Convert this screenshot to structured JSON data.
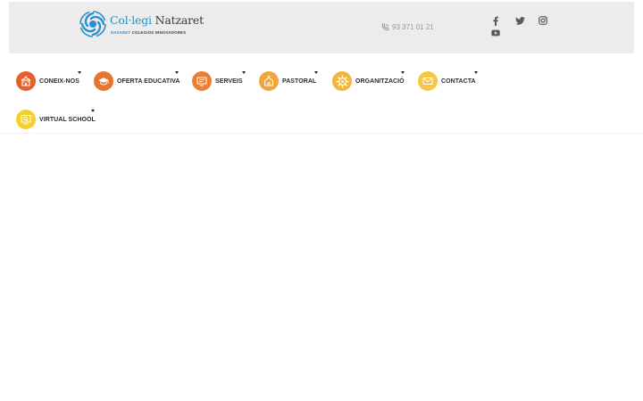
{
  "header": {
    "logo": {
      "name_part1": "Col·legi",
      "name_part2": "Natzaret",
      "tagline_part1": "NAZARET",
      "tagline_part2": "COLEGIOS INNOVADORES"
    },
    "phone": {
      "number": "93 371 01 21",
      "icon": "phone-icon"
    },
    "social": [
      {
        "name": "facebook",
        "icon": "facebook-icon"
      },
      {
        "name": "twitter",
        "icon": "twitter-icon"
      },
      {
        "name": "instagram",
        "icon": "instagram-icon"
      },
      {
        "name": "youtube",
        "icon": "youtube-icon"
      }
    ]
  },
  "nav": {
    "items": [
      {
        "label": "CONEIX-NOS",
        "icon": "school-icon",
        "color": "#e4612b"
      },
      {
        "label": "OFERTA EDUCATIVA",
        "icon": "graduation-cap-icon",
        "color": "#e8742f"
      },
      {
        "label": "SERVEIS",
        "icon": "screen-icon",
        "color": "#ec7d31"
      },
      {
        "label": "PASTORAL",
        "icon": "church-icon",
        "color": "#f1a53c"
      },
      {
        "label": "ORGANITZACIÓ",
        "icon": "cog-icon",
        "color": "#f2b63e"
      },
      {
        "label": "CONTACTA",
        "icon": "envelope-icon",
        "color": "#f6c744"
      },
      {
        "label": "VIRTUAL SCHOOL",
        "icon": "virtual-school-icon",
        "color": "#f6cf2b"
      }
    ]
  },
  "colors": {
    "topbar_bg": "#ececec",
    "brand_blue": "#2a8fce",
    "text_dark": "#2b2b2b",
    "muted": "#9a9a9a"
  }
}
